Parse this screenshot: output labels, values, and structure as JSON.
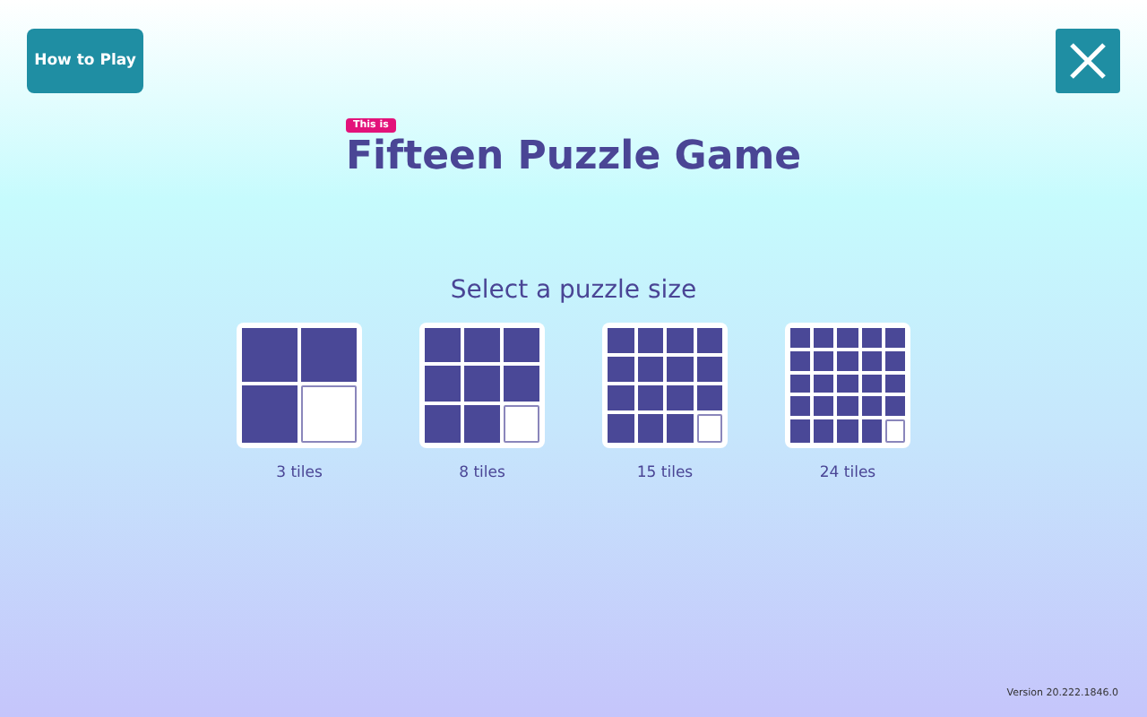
{
  "how_to_play_button": {
    "label": "How to Play"
  },
  "close_button": {
    "kind": "close"
  },
  "badge": "This is",
  "title": "Fifteen Puzzle Game",
  "prompt": "Select a puzzle size",
  "sizes": [
    {
      "kind": "two",
      "label": "3 tiles"
    },
    {
      "kind": "three",
      "label": "8 tiles"
    },
    {
      "kind": "four",
      "label": "15 tiles"
    },
    {
      "kind": "five",
      "label": "24 tiles"
    }
  ],
  "version": "Version 20.222.1846.0"
}
